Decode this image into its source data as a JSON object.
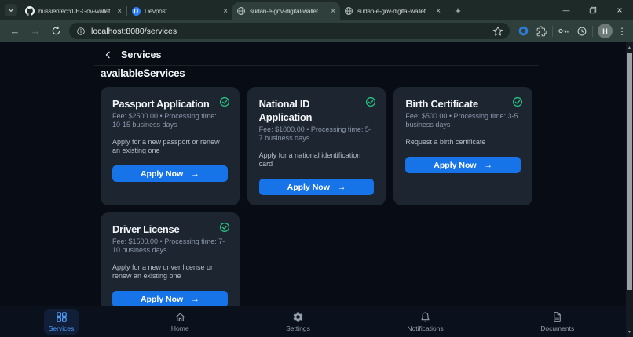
{
  "browser": {
    "tabs": [
      {
        "title": "hussientech1/E-Gov-wallet",
        "icon": "github"
      },
      {
        "title": "Devpost",
        "icon": "devpost",
        "icon_letter": "D"
      },
      {
        "title": "sudan-e-gov-digital-wallet",
        "icon": "globe"
      },
      {
        "title": "sudan-e-gov-digital-wallet",
        "icon": "globe"
      }
    ],
    "url": "localhost:8080/services",
    "profile_initial": "H"
  },
  "icons": {
    "close": "×",
    "back": "←",
    "forward": "→",
    "kebab": "⋮",
    "minimize": "—",
    "new_tab": "+",
    "up_arrow": "▲",
    "down_arrow": "▼",
    "button_arrow": "→"
  },
  "app": {
    "header_title": "Services",
    "section_title": "availableServices",
    "services": [
      {
        "name": "Passport Application",
        "meta": "Fee: $2500.00 • Processing time: 10-15 business days",
        "description": "Apply for a new passport or renew an existing one",
        "cta": "Apply Now"
      },
      {
        "name": "National ID Application",
        "meta": "Fee: $1000.00 • Processing time: 5-7 business days",
        "description": "Apply for a national identification card",
        "cta": "Apply Now"
      },
      {
        "name": "Birth Certificate",
        "meta": "Fee: $500.00 • Processing time: 3-5 business days",
        "description": "Request a birth certificate",
        "cta": "Apply Now"
      },
      {
        "name": "Driver License",
        "meta": "Fee: $1500.00 • Processing time: 7-10 business days",
        "description": "Apply for a new driver license or renew an existing one",
        "cta": "Apply Now"
      }
    ],
    "nav": [
      {
        "label": "Services",
        "icon": "grid",
        "active": true
      },
      {
        "label": "Home",
        "icon": "home"
      },
      {
        "label": "Settings",
        "icon": "settings"
      },
      {
        "label": "Notifications",
        "icon": "bell"
      },
      {
        "label": "Documents",
        "icon": "document"
      }
    ],
    "colors": {
      "accent": "#1774e8",
      "success": "#26c281",
      "nav_active": "#4f9cf9"
    }
  }
}
